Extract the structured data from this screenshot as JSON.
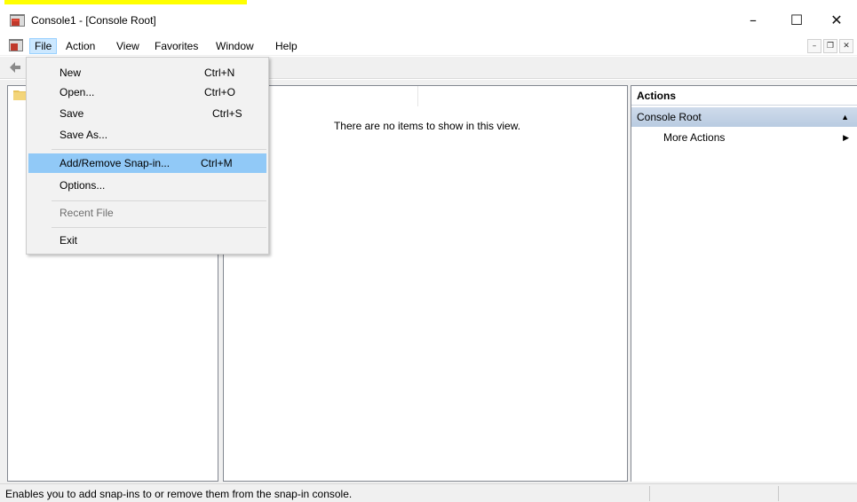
{
  "window": {
    "title": "Console1 - [Console Root]",
    "controls": {
      "minimize": "–",
      "maximize": "☐",
      "close": "✕"
    }
  },
  "menubar": {
    "items": [
      "File",
      "Action",
      "View",
      "Favorites",
      "Window",
      "Help"
    ],
    "active": "File",
    "mdi_controls": {
      "minimize": "–",
      "restore": "❐",
      "close": "✕"
    }
  },
  "file_menu": {
    "items": [
      {
        "label": "New",
        "shortcut": "Ctrl+N"
      },
      {
        "label": "Open...",
        "shortcut": "Ctrl+O"
      },
      {
        "label": "Save",
        "shortcut": "Ctrl+S"
      },
      {
        "label": "Save As...",
        "shortcut": ""
      },
      {
        "label": "Add/Remove Snap-in...",
        "shortcut": "Ctrl+M",
        "highlighted": true
      },
      {
        "label": "Options...",
        "shortcut": ""
      },
      {
        "label": "Recent File",
        "shortcut": "",
        "disabled": true
      },
      {
        "label": "Exit",
        "shortcut": ""
      }
    ]
  },
  "result_pane": {
    "empty_message": "There are no items to show in this view."
  },
  "actions": {
    "header": "Actions",
    "group": "Console Root",
    "group_arrow": "▲",
    "more": "More Actions",
    "more_arrow": "▶"
  },
  "statusbar": {
    "text": "Enables you to add snap-ins to or remove them from the snap-in console."
  },
  "colors": {
    "menu_highlight": "#91c9f7",
    "menubar_active": "#cce8ff",
    "actions_group": "#c4d3e7"
  }
}
